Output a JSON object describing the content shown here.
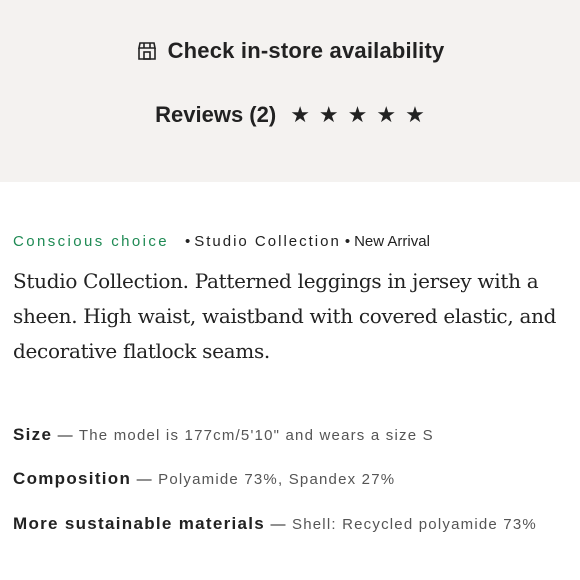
{
  "store": {
    "label": "Check in-store availability",
    "icon": "store-icon"
  },
  "reviews": {
    "label": "Reviews (2)",
    "stars": 5
  },
  "tags": {
    "conscious": "Conscious choice",
    "collection": "Studio Collection",
    "new": "New Arrival"
  },
  "description": "Studio Collection. Patterned leggings in jersey with a sheen. High waist, waistband with covered elastic, and decorative flatlock seams.",
  "attributes": {
    "size": {
      "label": "Size",
      "value": "The model is 177cm/5'10\" and wears a size S"
    },
    "composition": {
      "label": "Composition",
      "value": "Polyamide 73%, Spandex 27%"
    },
    "materials": {
      "label": "More sustainable materials",
      "value": "Shell: Recycled polyamide 73%"
    }
  },
  "colors": {
    "accent_green": "#1f8a54",
    "panel_bg": "#f4f2f0"
  }
}
